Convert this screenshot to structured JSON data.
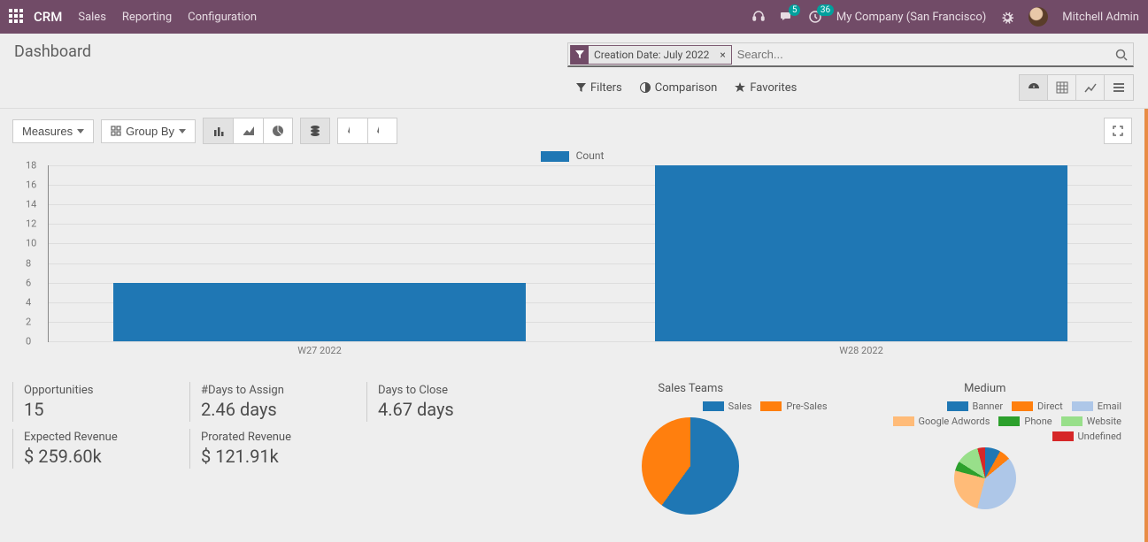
{
  "nav": {
    "brand": "CRM",
    "items": [
      "Sales",
      "Reporting",
      "Configuration"
    ],
    "msg_badge": "5",
    "clock_badge": "36",
    "company": "My Company (San Francisco)",
    "user": "Mitchell Admin"
  },
  "page": {
    "title": "Dashboard",
    "search_placeholder": "Search...",
    "filter_label": "Creation Date: July 2022",
    "toolbar": {
      "filters": "Filters",
      "comparison": "Comparison",
      "favorites": "Favorites"
    },
    "measures": "Measures",
    "groupby": "Group By"
  },
  "chart_data": {
    "type": "bar",
    "legend": "Count",
    "categories": [
      "W27 2022",
      "W28 2022"
    ],
    "values": [
      6,
      18
    ],
    "ylim": [
      0,
      18
    ],
    "yticks": [
      0,
      2,
      4,
      6,
      8,
      10,
      12,
      14,
      16,
      18
    ]
  },
  "kpis": {
    "opportunities": {
      "label": "Opportunities",
      "value": "15"
    },
    "days_assign": {
      "label": "#Days to Assign",
      "value": "2.46 days"
    },
    "days_close": {
      "label": "Days to Close",
      "value": "4.67 days"
    },
    "expected": {
      "label": "Expected Revenue",
      "value": "$ 259.60k"
    },
    "prorated": {
      "label": "Prorated Revenue",
      "value": "$ 121.91k"
    }
  },
  "mini": {
    "sales_teams": {
      "title": "Sales Teams",
      "legend": [
        {
          "name": "Sales",
          "color": "#1f77b4"
        },
        {
          "name": "Pre-Sales",
          "color": "#ff7f0e"
        }
      ],
      "slices": [
        {
          "v": 60,
          "c": "#1f77b4"
        },
        {
          "v": 40,
          "c": "#ff7f0e"
        }
      ]
    },
    "medium": {
      "title": "Medium",
      "legend": [
        {
          "name": "Banner",
          "color": "#1f77b4"
        },
        {
          "name": "Direct",
          "color": "#ff7f0e"
        },
        {
          "name": "Email",
          "color": "#aec7e8"
        },
        {
          "name": "Google Adwords",
          "color": "#ffbb78"
        },
        {
          "name": "Phone",
          "color": "#2ca02c"
        },
        {
          "name": "Website",
          "color": "#98df8a"
        },
        {
          "name": "Undefined",
          "color": "#d62728"
        }
      ],
      "slices": [
        {
          "v": 8,
          "c": "#1f77b4"
        },
        {
          "v": 6,
          "c": "#ff7f0e"
        },
        {
          "v": 40,
          "c": "#aec7e8"
        },
        {
          "v": 25,
          "c": "#ffbb78"
        },
        {
          "v": 5,
          "c": "#2ca02c"
        },
        {
          "v": 12,
          "c": "#98df8a"
        },
        {
          "v": 4,
          "c": "#d62728"
        }
      ]
    }
  }
}
